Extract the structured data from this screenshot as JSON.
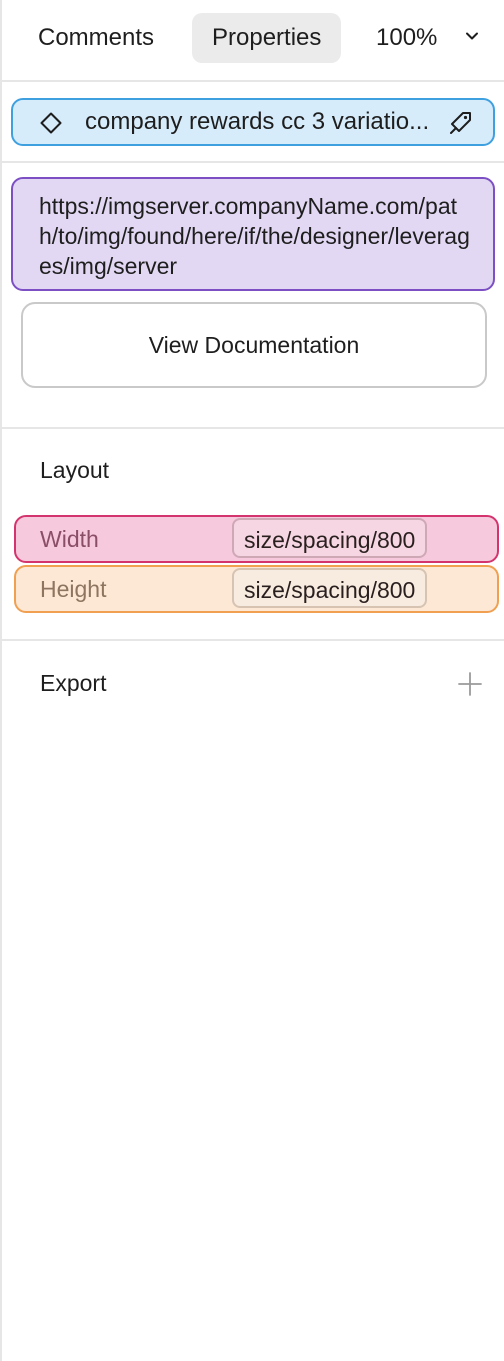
{
  "header": {
    "tabs": [
      {
        "label": "Comments",
        "active": false
      },
      {
        "label": "Properties",
        "active": true
      }
    ],
    "zoom": "100%"
  },
  "component": {
    "name": "company rewards cc 3 variatio..."
  },
  "url": {
    "text": "https://imgserver.companyName.com/path/to/img/found/here/if/the/designer/leverages/img/server"
  },
  "documentation": {
    "button_label": "View Documentation"
  },
  "layout": {
    "title": "Layout",
    "width": {
      "label": "Width",
      "value": "size/spacing/800"
    },
    "height": {
      "label": "Height",
      "value": "size/spacing/800"
    }
  },
  "export": {
    "title": "Export"
  },
  "colors": {
    "component_bg": "#d6ecfb",
    "component_border": "#3fa0e0",
    "url_bg": "#e2d8f3",
    "url_border": "#7c4fc4",
    "width_bg": "#f7c9dd",
    "width_border": "#d4346e",
    "height_bg": "#fde8d6",
    "height_border": "#f0a050"
  },
  "icons": {
    "component": "diamond-icon",
    "goto_component": "component-link-icon",
    "zoom_menu": "chevron-down-icon",
    "add_export": "plus-icon"
  }
}
